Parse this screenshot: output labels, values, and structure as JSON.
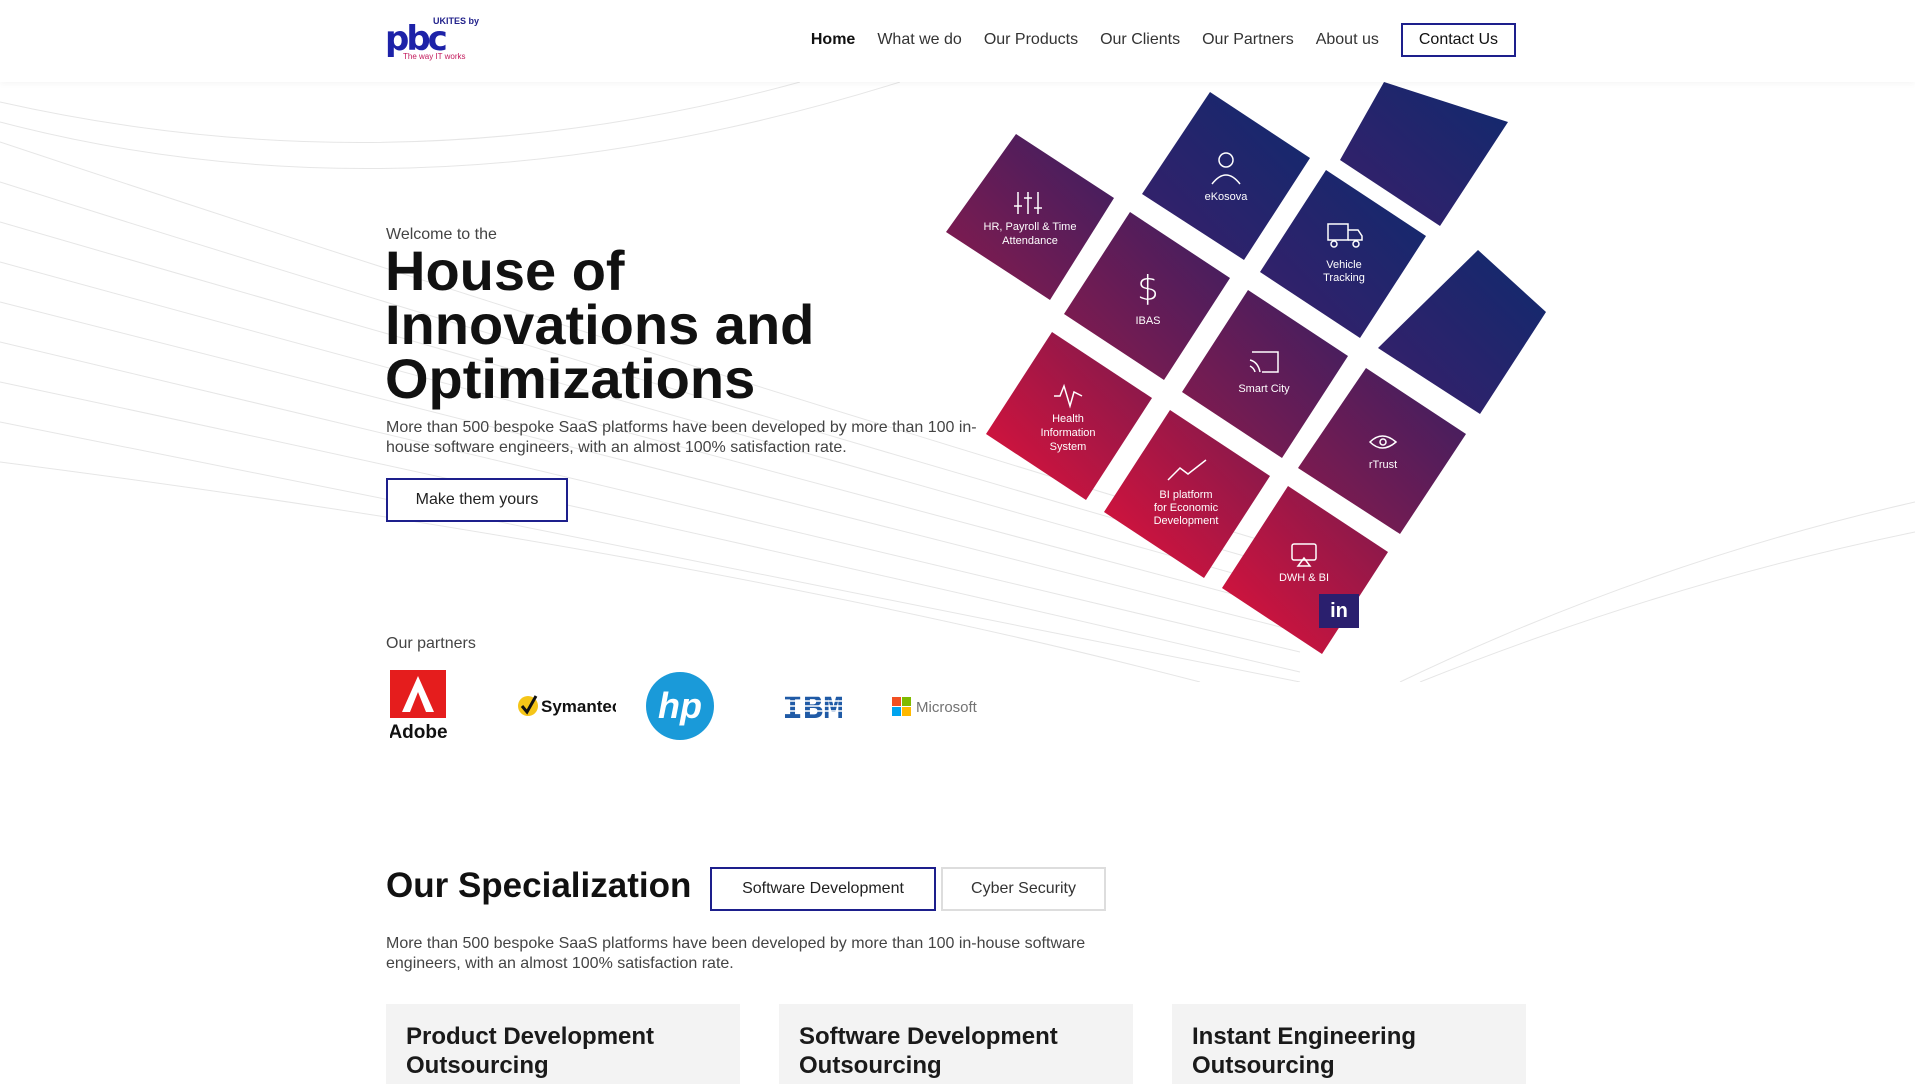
{
  "header": {
    "logo_top": "UKITES by",
    "logo_main": "pbc",
    "logo_tagline": "The way IT works",
    "nav": [
      {
        "label": "Home",
        "active": true
      },
      {
        "label": "What we do"
      },
      {
        "label": "Our Products"
      },
      {
        "label": "Our Clients"
      },
      {
        "label": "Our Partners"
      },
      {
        "label": "About us"
      }
    ],
    "contact_label": "Contact Us"
  },
  "hero": {
    "welcome": "Welcome to the",
    "title": "House of Innovations and Optimizations",
    "description": "More than 500 bespoke SaaS platforms have been developed by more than 100 in-house software engineers, with an almost 100% satisfaction rate.",
    "cta_label": "Make them yours"
  },
  "tiles": [
    {
      "label": "HR, Payroll & Time Attendance",
      "icon": "sliders-icon"
    },
    {
      "label": "eKosova",
      "icon": "user-icon"
    },
    {
      "label": "",
      "icon": ""
    },
    {
      "label": "IBAS",
      "icon": "dollar-icon"
    },
    {
      "label": "Vehicle Tracking",
      "icon": "truck-icon"
    },
    {
      "label": "Health Information System",
      "icon": "pulse-icon"
    },
    {
      "label": "Smart City",
      "icon": "cast-icon"
    },
    {
      "label": "",
      "icon": ""
    },
    {
      "label": "BI platform for Economic Development",
      "icon": "trending-up-icon"
    },
    {
      "label": "rTrust",
      "icon": "eye-icon"
    },
    {
      "label": "DWH & BI",
      "icon": "airplay-icon"
    }
  ],
  "linkedin_label": "in",
  "partners": {
    "label": "Our partners",
    "logos": [
      "Adobe",
      "Symantec",
      "hp",
      "IBM",
      "Microsoft"
    ]
  },
  "specialization": {
    "title": "Our Specialization",
    "tabs": [
      {
        "label": "Software Development",
        "active": true
      },
      {
        "label": "Cyber Security"
      }
    ],
    "description": "More than 500 bespoke SaaS platforms have been developed by more than 100 in-house software engineers, with an almost 100% satisfaction rate.",
    "cards": [
      {
        "title": "Product Development Outsourcing"
      },
      {
        "title": "Software Development Outsourcing"
      },
      {
        "title": "Instant Engineering Outsourcing"
      }
    ]
  },
  "colors": {
    "navy": "#1d1f8c",
    "tile_top": "#1e2a6e",
    "tile_mid": "#6a1a55",
    "tile_red": "#d0143b"
  }
}
